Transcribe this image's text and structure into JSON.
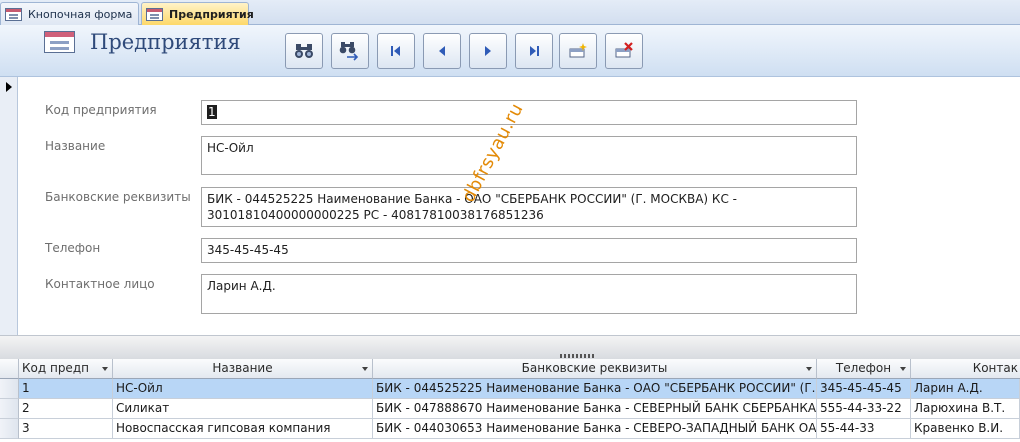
{
  "tabs": [
    {
      "label": "Кнопочная форма",
      "active": false
    },
    {
      "label": "Предприятия",
      "active": true
    }
  ],
  "header": {
    "title": "Предприятия",
    "buttons": [
      {
        "name": "find-button",
        "icon": "binoculars-icon"
      },
      {
        "name": "replace-button",
        "icon": "binoculars-replace-icon"
      },
      {
        "name": "first-record-button",
        "icon": "first-record-icon"
      },
      {
        "name": "previous-record-button",
        "icon": "previous-record-icon"
      },
      {
        "name": "next-record-button",
        "icon": "next-record-icon"
      },
      {
        "name": "last-record-button",
        "icon": "last-record-icon"
      },
      {
        "name": "new-record-button",
        "icon": "new-record-icon"
      },
      {
        "name": "delete-record-button",
        "icon": "delete-record-icon"
      }
    ]
  },
  "form": {
    "fields": [
      {
        "label": "Код предприятия",
        "value": "1"
      },
      {
        "label": "Название",
        "value": "НС-Ойл"
      },
      {
        "label": "Банковские реквизиты",
        "value": "БИК - 044525225 Наименование Банка - ОАО \"СБЕРБАНК РОССИИ\" (Г. МОСКВА) КС - 30101810400000000225 РС - 40817810038176851236"
      },
      {
        "label": "Телефон",
        "value": "345-45-45-45"
      },
      {
        "label": "Контактное лицо",
        "value": "Ларин А.Д."
      }
    ]
  },
  "watermark": "dbfrsyau.ru",
  "datasheet": {
    "columns": [
      "Код предп",
      "Название",
      "Банковские реквизиты",
      "Телефон",
      "Контак"
    ],
    "rows": [
      {
        "code": "1",
        "name": "НС-Ойл",
        "bank": "БИК - 044525225 Наименование Банка - ОАО \"СБЕРБАНК РОССИИ\" (Г. М",
        "phone": "345-45-45-45",
        "contact": "Ларин А.Д."
      },
      {
        "code": "2",
        "name": "Силикат",
        "bank": "БИК - 047888670 Наименование Банка - СЕВЕРНЫЙ БАНК СБЕРБАНКА РО",
        "phone": "555-44-33-22",
        "contact": "Ларюхина В.Т."
      },
      {
        "code": "3",
        "name": "Новоспасская гипсовая компания",
        "bank": "БИК - 044030653 Наименование Банка - СЕВЕРО-ЗАПАДНЫЙ БАНК ОАО",
        "phone": "55-44-33",
        "contact": "Кравенко В.И."
      }
    ]
  },
  "colors": {
    "active_tab": "#fdd86a",
    "selected_row": "#b8d6f6",
    "title": "#2f4a7a",
    "watermark": "#e38a06"
  }
}
